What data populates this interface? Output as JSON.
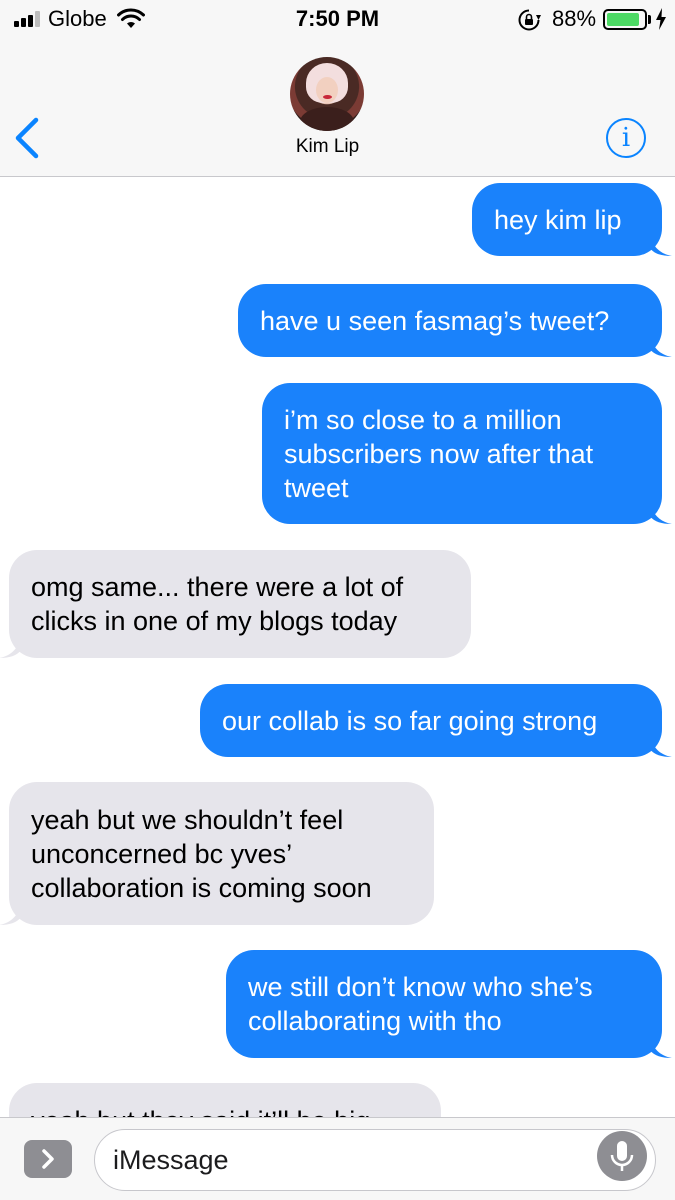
{
  "status_bar": {
    "carrier": "Globe",
    "time": "7:50 PM",
    "battery_percent": "88%",
    "battery_level": 0.88,
    "icons": [
      "signal-icon",
      "wifi-icon",
      "rotation-lock-icon",
      "battery-icon",
      "charging-bolt-icon"
    ]
  },
  "header": {
    "contact_name": "Kim Lip",
    "info_glyph": "i",
    "back_icon": "chevron-left-icon"
  },
  "colors": {
    "sent_bubble": "#1a82fb",
    "received_bubble": "#e6e5eb",
    "accent": "#0a84ff"
  },
  "messages": [
    {
      "direction": "sent",
      "lines": [
        "hey kim lip"
      ]
    },
    {
      "direction": "sent",
      "lines": [
        "have u seen fasmag’s tweet?"
      ]
    },
    {
      "direction": "sent",
      "lines": [
        "i’m so close to a million",
        "subscribers now after that",
        "tweet"
      ]
    },
    {
      "direction": "received",
      "lines": [
        "omg same... there were a lot of",
        "clicks in one of my blogs today"
      ]
    },
    {
      "direction": "sent",
      "lines": [
        "our collab is so far going strong"
      ]
    },
    {
      "direction": "received",
      "lines": [
        "yeah but we shouldn’t feel",
        "unconcerned bc yves’",
        "collaboration is coming soon"
      ]
    },
    {
      "direction": "sent",
      "lines": [
        "we still don’t know who she’s",
        "collaborating with tho"
      ]
    },
    {
      "direction": "received",
      "lines": [
        "yeah but they said it’ll be big"
      ]
    }
  ],
  "composer": {
    "placeholder": "iMessage",
    "value": ""
  }
}
